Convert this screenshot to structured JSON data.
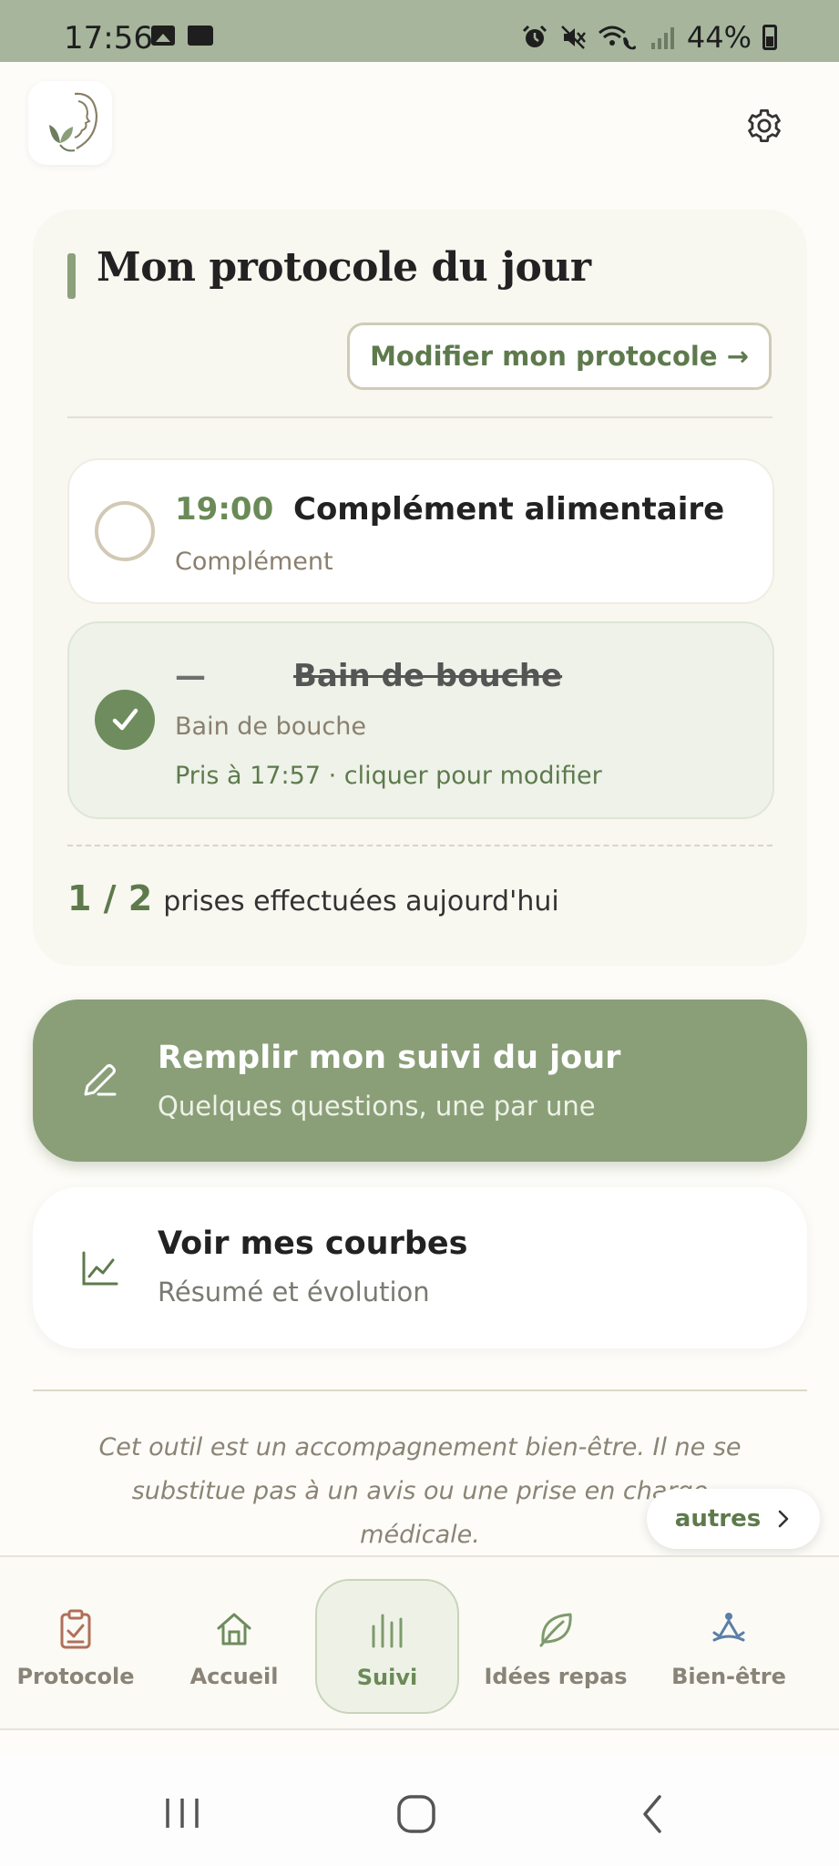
{
  "status_bar": {
    "time": "17:56",
    "battery": "44%",
    "icons": [
      "image-icon",
      "folder-icon",
      "alarm-icon",
      "mute-icon",
      "wifi-call-icon",
      "signal-icon",
      "battery-icon"
    ]
  },
  "header": {
    "logo_icon": "face-leaf-logo",
    "settings_icon": "gear-icon"
  },
  "protocol": {
    "title": "Mon protocole du jour",
    "modify_label": "Modifier mon protocole →",
    "items": [
      {
        "time": "19:00",
        "name": "Complément alimentaire",
        "category": "Complément",
        "done": false
      },
      {
        "time": "—",
        "name": "Bain de bouche",
        "category": "Bain de bouche",
        "done": true,
        "taken_text": "Pris à 17:57 · cliquer pour modifier"
      }
    ],
    "count": "1 / 2",
    "count_label": "prises effectuées aujourd'hui"
  },
  "actions": {
    "fill": {
      "title": "Remplir mon suivi du jour",
      "subtitle": "Quelques questions, une par une",
      "icon": "pencil-icon"
    },
    "curves": {
      "title": "Voir mes courbes",
      "subtitle": "Résumé et évolution",
      "icon": "chart-line-icon"
    }
  },
  "disclaimer": "Cet outil est un accompagnement bien-être. Il ne se substitue pas à un avis ou une prise en charge médicale.",
  "others_label": "autres",
  "tabs": [
    {
      "label": "Protocole",
      "icon": "clipboard-check-icon",
      "active": false
    },
    {
      "label": "Accueil",
      "icon": "home-icon",
      "active": false
    },
    {
      "label": "Suivi",
      "icon": "bars-icon",
      "active": true
    },
    {
      "label": "Idées repas",
      "icon": "leaf-icon",
      "active": false
    },
    {
      "label": "Bien-être",
      "icon": "meditation-icon",
      "active": false
    }
  ],
  "colors": {
    "accent": "#8a9f78",
    "accent_dark": "#5e7a4d",
    "status_bar": "#a6b59c",
    "card_bg": "#f8f7f0",
    "done_bg": "#eef2e9"
  }
}
